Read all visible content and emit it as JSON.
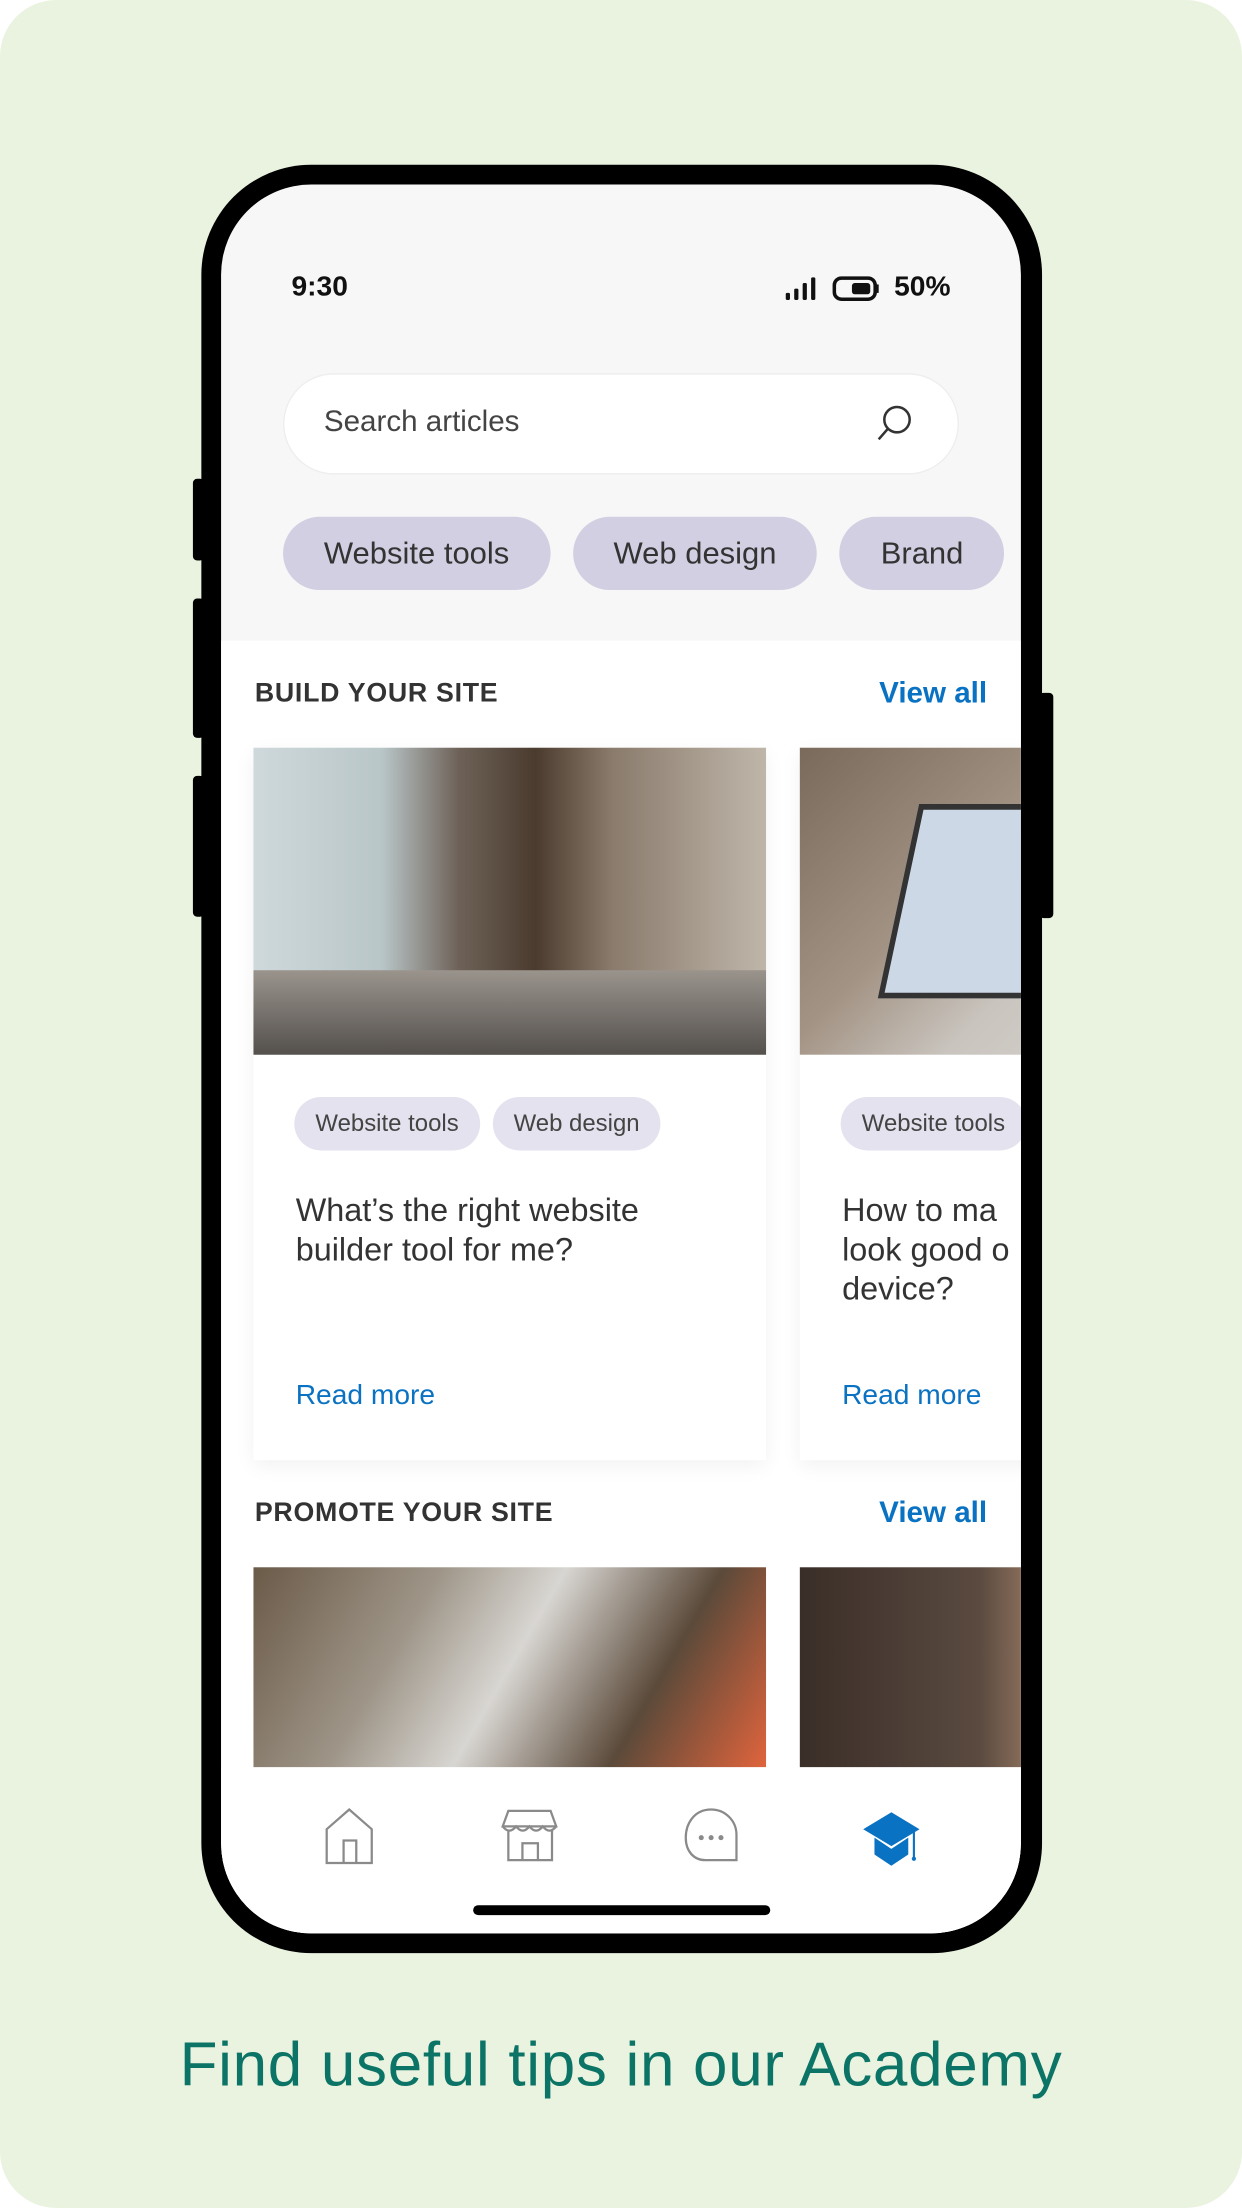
{
  "status_bar": {
    "time": "9:30",
    "battery": "50%",
    "signal_icon": "signal-bars-icon",
    "battery_icon": "battery-half-icon"
  },
  "search": {
    "placeholder": "Search articles",
    "icon": "search-icon"
  },
  "filter_chips": [
    "Website tools",
    "Web design",
    "Brand"
  ],
  "sections": [
    {
      "title": "BUILD YOUR SITE",
      "view_all": "View all",
      "cards": [
        {
          "tags": [
            "Website tools",
            "Web design"
          ],
          "title": "What’s the right website builder tool for me?",
          "link": "Read more"
        },
        {
          "tags": [
            "Website tools"
          ],
          "title": "How to make your site look good on any device?",
          "title_visible": "How to ma look good o device?",
          "link": "Read more"
        }
      ]
    },
    {
      "title": "PROMOTE YOUR SITE",
      "view_all": "View all"
    }
  ],
  "bottom_nav": [
    {
      "icon": "home-icon",
      "active": false
    },
    {
      "icon": "store-icon",
      "active": false
    },
    {
      "icon": "chat-bubble-icon",
      "active": false
    },
    {
      "icon": "graduation-cap-icon",
      "active": true
    }
  ],
  "colors": {
    "accent": "#0a72c2",
    "chip": "#d3cfe3",
    "background": "#eaf3df",
    "tagline": "#0c7466"
  },
  "tagline": "Find useful tips in our Academy"
}
